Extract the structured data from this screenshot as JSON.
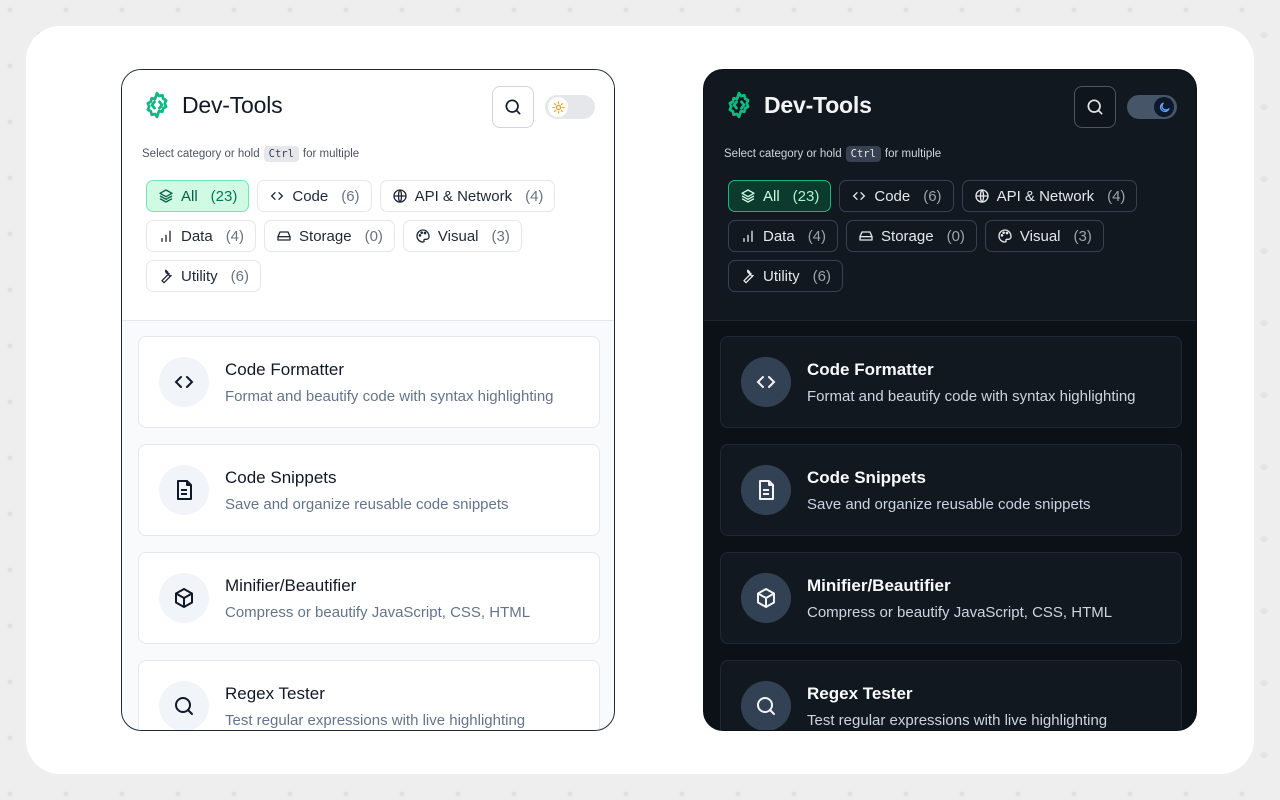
{
  "app": {
    "title": "Dev-Tools"
  },
  "hint": {
    "before": "Select category or hold",
    "key": "Ctrl",
    "after": "for multiple"
  },
  "categories": [
    {
      "label": "All",
      "count": "(23)",
      "icon": "layers-icon",
      "active": true
    },
    {
      "label": "Code",
      "count": "(6)",
      "icon": "code-icon",
      "active": false
    },
    {
      "label": "API & Network",
      "count": "(4)",
      "icon": "globe-icon",
      "active": false
    },
    {
      "label": "Data",
      "count": "(4)",
      "icon": "bar-chart-icon",
      "active": false
    },
    {
      "label": "Storage",
      "count": "(0)",
      "icon": "hard-drive-icon",
      "active": false
    },
    {
      "label": "Visual",
      "count": "(3)",
      "icon": "palette-icon",
      "active": false
    },
    {
      "label": "Utility",
      "count": "(6)",
      "icon": "wrench-icon",
      "active": false
    }
  ],
  "tools": [
    {
      "name": "Code Formatter",
      "description": "Format and beautify code with syntax highlighting",
      "icon": "code-icon"
    },
    {
      "name": "Code Snippets",
      "description": "Save and organize reusable code snippets",
      "icon": "file-text-icon"
    },
    {
      "name": "Minifier/Beautifier",
      "description": "Compress or beautify JavaScript, CSS, HTML",
      "icon": "box-icon"
    },
    {
      "name": "Regex Tester",
      "description": "Test regular expressions with live highlighting",
      "icon": "search-icon"
    }
  ],
  "colors": {
    "brand": "#10b981",
    "light_bg": "#ffffff",
    "dark_bg": "#0b1117"
  }
}
